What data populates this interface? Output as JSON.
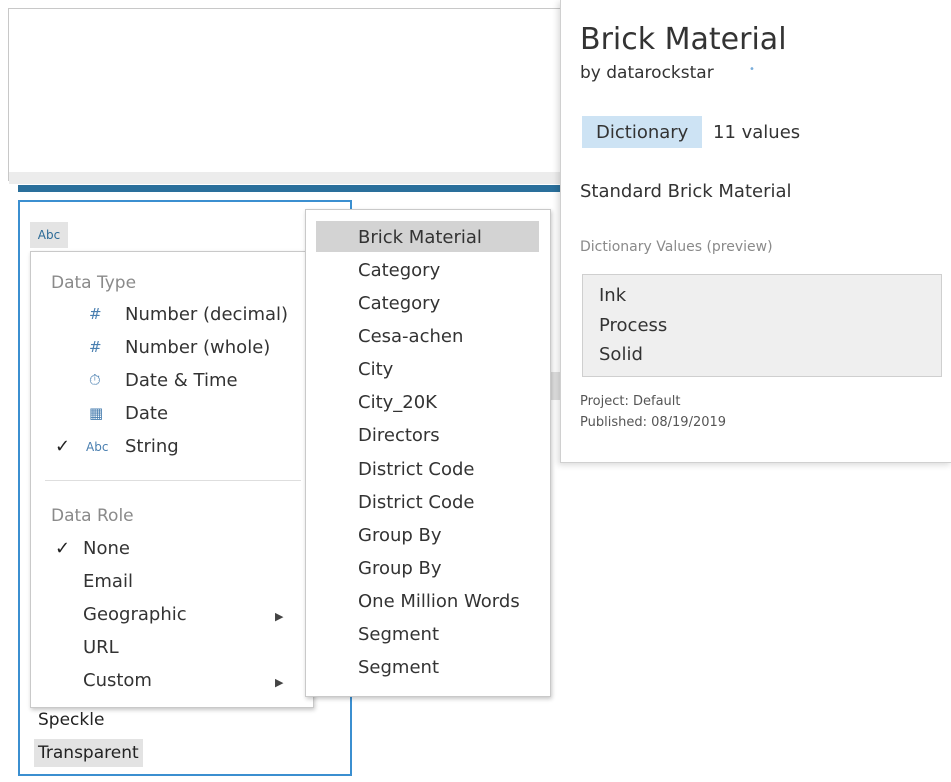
{
  "column": {
    "type_tag": "Abc",
    "bottom_values": [
      "Speckle",
      "Transparent"
    ]
  },
  "type_menu": {
    "data_type_label": "Data Type",
    "data_types": [
      {
        "icon": "#",
        "icon_name": "number-decimal-icon",
        "label": "Number (decimal)",
        "checked": false
      },
      {
        "icon": "#",
        "icon_name": "number-whole-icon",
        "label": "Number (whole)",
        "checked": false
      },
      {
        "icon": "⏱",
        "icon_name": "datetime-icon",
        "label": "Date & Time",
        "checked": false
      },
      {
        "icon": "▦",
        "icon_name": "calendar-icon",
        "label": "Date",
        "checked": false
      },
      {
        "icon": "Abc",
        "icon_name": "string-icon",
        "label": "String",
        "checked": true
      }
    ],
    "data_role_label": "Data Role",
    "data_roles": [
      {
        "label": "None",
        "checked": true,
        "submenu": false
      },
      {
        "label": "Email",
        "checked": false,
        "submenu": false
      },
      {
        "label": "Geographic",
        "checked": false,
        "submenu": true
      },
      {
        "label": "URL",
        "checked": false,
        "submenu": false
      },
      {
        "label": "Custom",
        "checked": false,
        "submenu": true
      }
    ],
    "check_glyph": "✓",
    "submenu_glyph": "▶"
  },
  "dictionary_list": {
    "selected_index": 0,
    "items": [
      "Brick Material",
      "Category",
      "Category",
      "Cesa-achen",
      "City",
      "City_20K",
      "Directors",
      "District Code",
      "District Code",
      "Group By",
      "Group By",
      "One Million Words",
      "Segment",
      "Segment"
    ]
  },
  "detail_card": {
    "title": "Brick Material",
    "byline": "by  datarockstar",
    "badge": "Dictionary",
    "values_count": "11 values",
    "description": "Standard Brick Material",
    "preview_label": "Dictionary Values (preview)",
    "preview_values": [
      "Ink",
      "Process",
      "Solid"
    ],
    "project": "Project: Default",
    "published": "Published: 08/19/2019",
    "colors": {
      "badge_bg": "#cde3f4",
      "accent_blue": "#3b8fd0"
    }
  }
}
